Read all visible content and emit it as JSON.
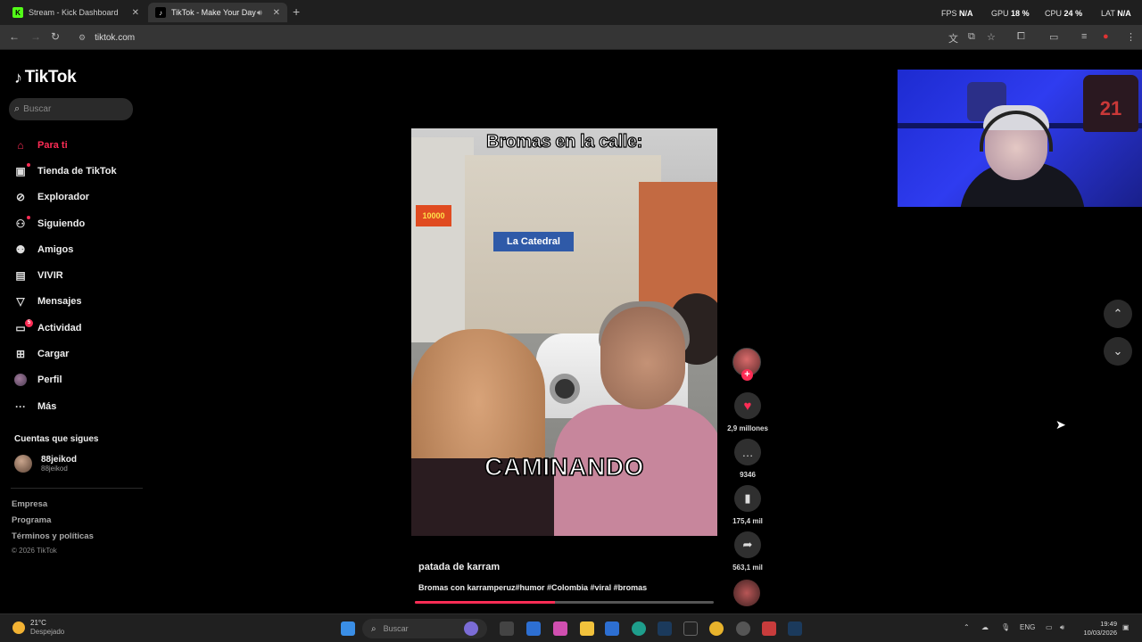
{
  "browser": {
    "tabs": [
      {
        "title": "Stream - Kick Dashboard",
        "favicon": "K"
      },
      {
        "title": "TikTok - Make Your Day",
        "favicon": "♪"
      }
    ],
    "url": "tiktok.com",
    "perf": {
      "fps_label": "FPS",
      "fps": "N/A",
      "gpu_label": "GPU",
      "gpu": "18",
      "gpu_unit": "%",
      "cpu_label": "CPU",
      "cpu": "24",
      "cpu_unit": "%",
      "lat_label": "LAT",
      "lat": "N/A"
    }
  },
  "tiktok": {
    "logo": "TikTok",
    "search_placeholder": "Buscar",
    "nav": [
      {
        "label": "Para ti",
        "icon": "home-icon",
        "active": true
      },
      {
        "label": "Tienda de TikTok",
        "icon": "shop-icon"
      },
      {
        "label": "Explorador",
        "icon": "compass-icon"
      },
      {
        "label": "Siguiendo",
        "icon": "following-icon"
      },
      {
        "label": "Amigos",
        "icon": "friends-icon"
      },
      {
        "label": "VIVIR",
        "icon": "live-icon"
      },
      {
        "label": "Mensajes",
        "icon": "messages-icon"
      },
      {
        "label": "Actividad",
        "icon": "activity-icon",
        "badge": "5"
      },
      {
        "label": "Cargar",
        "icon": "upload-icon"
      },
      {
        "label": "Perfil",
        "icon": "profile-avatar"
      },
      {
        "label": "Más",
        "icon": "more-icon"
      }
    ],
    "following_title": "Cuentas que sigues",
    "following": [
      {
        "name": "88jeikod",
        "handle": "88jeikod"
      }
    ],
    "footer": [
      "Empresa",
      "Programa",
      "Términos y políticas"
    ],
    "copyright": "© 2026 TikTok"
  },
  "video": {
    "overlay_title": "Bromas en la calle:",
    "overlay_caption": "CAMINANDO",
    "sign_text": "La Catedral",
    "author": "patada de karram",
    "description": "Bromas con karramperuz#humor #Colombia #viral #bromas",
    "progress": 0.47,
    "likes": "2,9 millones",
    "comments": "9346",
    "saves": "175,4 mil",
    "shares": "563,1 mil"
  },
  "webcam": {
    "jersey_number": "21"
  },
  "taskbar": {
    "weather_temp": "21°C",
    "weather_desc": "Despejado",
    "search_placeholder": "Buscar",
    "lang": "ENG",
    "time": "19:49",
    "date": "10/03/2026"
  },
  "colors": {
    "accent": "#fe2c55",
    "background": "#000000"
  }
}
